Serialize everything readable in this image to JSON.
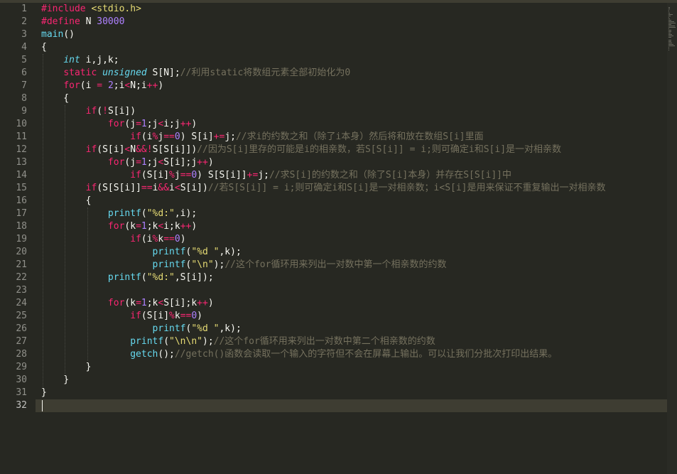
{
  "colors": {
    "background": "#272822",
    "foreground": "#f8f8f2",
    "keyword": "#f92672",
    "type": "#66d9ef",
    "function": "#66d9ef",
    "string": "#e6db74",
    "number": "#ae81ff",
    "comment": "#75715e",
    "line_number": "#90908a"
  },
  "editor": {
    "active_line": 32,
    "lines": [
      {
        "n": "1",
        "tokens": [
          [
            "pp",
            "#include "
          ],
          [
            "st",
            "<stdio.h>"
          ]
        ]
      },
      {
        "n": "2",
        "tokens": [
          [
            "pp",
            "#define "
          ],
          [
            "pl",
            "N "
          ],
          [
            "nu",
            "30000"
          ]
        ]
      },
      {
        "n": "3",
        "tokens": [
          [
            "fn",
            "main"
          ],
          [
            "pl",
            "()"
          ]
        ]
      },
      {
        "n": "4",
        "tokens": [
          [
            "pl",
            "{"
          ]
        ]
      },
      {
        "n": "5",
        "tokens": [
          [
            "pl",
            "    "
          ],
          [
            "ty",
            "int"
          ],
          [
            "pl",
            " i,j,k;"
          ]
        ]
      },
      {
        "n": "6",
        "tokens": [
          [
            "pl",
            "    "
          ],
          [
            "pp",
            "static "
          ],
          [
            "ty",
            "unsigned"
          ],
          [
            "pl",
            " S[N];"
          ],
          [
            "cm",
            "//利用static将数组元素全部初始化为0"
          ]
        ]
      },
      {
        "n": "7",
        "tokens": [
          [
            "pl",
            "    "
          ],
          [
            "pp",
            "for"
          ],
          [
            "pl",
            "(i "
          ],
          [
            "pp",
            "="
          ],
          [
            "pl",
            " "
          ],
          [
            "nu",
            "2"
          ],
          [
            "pl",
            ";i"
          ],
          [
            "pp",
            "<"
          ],
          [
            "pl",
            "N;i"
          ],
          [
            "pp",
            "++"
          ],
          [
            "pl",
            ")"
          ]
        ]
      },
      {
        "n": "8",
        "tokens": [
          [
            "pl",
            "    {"
          ]
        ]
      },
      {
        "n": "9",
        "tokens": [
          [
            "pl",
            "        "
          ],
          [
            "pp",
            "if"
          ],
          [
            "pl",
            "("
          ],
          [
            "pp",
            "!"
          ],
          [
            "pl",
            "S[i])"
          ]
        ]
      },
      {
        "n": "10",
        "tokens": [
          [
            "pl",
            "            "
          ],
          [
            "pp",
            "for"
          ],
          [
            "pl",
            "(j"
          ],
          [
            "pp",
            "="
          ],
          [
            "nu",
            "1"
          ],
          [
            "pl",
            ";j"
          ],
          [
            "pp",
            "<"
          ],
          [
            "pl",
            "i;j"
          ],
          [
            "pp",
            "++"
          ],
          [
            "pl",
            ")"
          ]
        ]
      },
      {
        "n": "11",
        "tokens": [
          [
            "pl",
            "                "
          ],
          [
            "pp",
            "if"
          ],
          [
            "pl",
            "(i"
          ],
          [
            "pp",
            "%"
          ],
          [
            "pl",
            "j"
          ],
          [
            "pp",
            "=="
          ],
          [
            "nu",
            "0"
          ],
          [
            "pl",
            ") S[i]"
          ],
          [
            "pp",
            "+="
          ],
          [
            "pl",
            "j;"
          ],
          [
            "cm",
            "//求i的约数之和（除了i本身）然后将和放在数组S[i]里面"
          ]
        ]
      },
      {
        "n": "12",
        "tokens": [
          [
            "pl",
            "        "
          ],
          [
            "pp",
            "if"
          ],
          [
            "pl",
            "(S[i]"
          ],
          [
            "pp",
            "<"
          ],
          [
            "pl",
            "N"
          ],
          [
            "pp",
            "&&!"
          ],
          [
            "pl",
            "S[S[i]])"
          ],
          [
            "cm",
            "//因为S[i]里存的可能是i的相亲数，若S[S[i]] = i;则可确定i和S[i]是一对相亲数"
          ]
        ]
      },
      {
        "n": "13",
        "tokens": [
          [
            "pl",
            "            "
          ],
          [
            "pp",
            "for"
          ],
          [
            "pl",
            "(j"
          ],
          [
            "pp",
            "="
          ],
          [
            "nu",
            "1"
          ],
          [
            "pl",
            ";j"
          ],
          [
            "pp",
            "<"
          ],
          [
            "pl",
            "S[i];j"
          ],
          [
            "pp",
            "++"
          ],
          [
            "pl",
            ")"
          ]
        ]
      },
      {
        "n": "14",
        "tokens": [
          [
            "pl",
            "                "
          ],
          [
            "pp",
            "if"
          ],
          [
            "pl",
            "(S[i]"
          ],
          [
            "pp",
            "%"
          ],
          [
            "pl",
            "j"
          ],
          [
            "pp",
            "=="
          ],
          [
            "nu",
            "0"
          ],
          [
            "pl",
            ") S[S[i]]"
          ],
          [
            "pp",
            "+="
          ],
          [
            "pl",
            "j;"
          ],
          [
            "cm",
            "//求S[i]的约数之和（除了S[i]本身）并存在S[S[i]]中"
          ]
        ]
      },
      {
        "n": "15",
        "tokens": [
          [
            "pl",
            "        "
          ],
          [
            "pp",
            "if"
          ],
          [
            "pl",
            "(S[S[i]]"
          ],
          [
            "pp",
            "=="
          ],
          [
            "pl",
            "i"
          ],
          [
            "pp",
            "&&"
          ],
          [
            "pl",
            "i"
          ],
          [
            "pp",
            "<"
          ],
          [
            "pl",
            "S[i])"
          ],
          [
            "cm",
            "//若S[S[i]] = i;则可确定i和S[i]是一对相亲数；i<S[i]是用来保证不重复输出一对相亲数"
          ]
        ]
      },
      {
        "n": "16",
        "tokens": [
          [
            "pl",
            "        {"
          ]
        ]
      },
      {
        "n": "17",
        "tokens": [
          [
            "pl",
            "            "
          ],
          [
            "fn",
            "printf"
          ],
          [
            "pl",
            "("
          ],
          [
            "st",
            "\"%d:\""
          ],
          [
            "pl",
            ",i);"
          ]
        ]
      },
      {
        "n": "18",
        "tokens": [
          [
            "pl",
            "            "
          ],
          [
            "pp",
            "for"
          ],
          [
            "pl",
            "(k"
          ],
          [
            "pp",
            "="
          ],
          [
            "nu",
            "1"
          ],
          [
            "pl",
            ";k"
          ],
          [
            "pp",
            "<"
          ],
          [
            "pl",
            "i;k"
          ],
          [
            "pp",
            "++"
          ],
          [
            "pl",
            ")"
          ]
        ]
      },
      {
        "n": "19",
        "tokens": [
          [
            "pl",
            "                "
          ],
          [
            "pp",
            "if"
          ],
          [
            "pl",
            "(i"
          ],
          [
            "pp",
            "%"
          ],
          [
            "pl",
            "k"
          ],
          [
            "pp",
            "=="
          ],
          [
            "nu",
            "0"
          ],
          [
            "pl",
            ")"
          ]
        ]
      },
      {
        "n": "20",
        "tokens": [
          [
            "pl",
            "                    "
          ],
          [
            "fn",
            "printf"
          ],
          [
            "pl",
            "("
          ],
          [
            "st",
            "\"%d \""
          ],
          [
            "pl",
            ",k);"
          ]
        ]
      },
      {
        "n": "21",
        "tokens": [
          [
            "pl",
            "                    "
          ],
          [
            "fn",
            "printf"
          ],
          [
            "pl",
            "("
          ],
          [
            "st",
            "\"\\n\""
          ],
          [
            "pl",
            ");"
          ],
          [
            "cm",
            "//这个for循环用来列出一对数中第一个相亲数的约数"
          ]
        ]
      },
      {
        "n": "22",
        "tokens": [
          [
            "pl",
            "            "
          ],
          [
            "fn",
            "printf"
          ],
          [
            "pl",
            "("
          ],
          [
            "st",
            "\"%d:\""
          ],
          [
            "pl",
            ",S[i]);"
          ]
        ]
      },
      {
        "n": "23",
        "tokens": []
      },
      {
        "n": "24",
        "tokens": [
          [
            "pl",
            "            "
          ],
          [
            "pp",
            "for"
          ],
          [
            "pl",
            "(k"
          ],
          [
            "pp",
            "="
          ],
          [
            "nu",
            "1"
          ],
          [
            "pl",
            ";k"
          ],
          [
            "pp",
            "<"
          ],
          [
            "pl",
            "S[i];k"
          ],
          [
            "pp",
            "++"
          ],
          [
            "pl",
            ")"
          ]
        ]
      },
      {
        "n": "25",
        "tokens": [
          [
            "pl",
            "                "
          ],
          [
            "pp",
            "if"
          ],
          [
            "pl",
            "(S[i]"
          ],
          [
            "pp",
            "%"
          ],
          [
            "pl",
            "k"
          ],
          [
            "pp",
            "=="
          ],
          [
            "nu",
            "0"
          ],
          [
            "pl",
            ")"
          ]
        ]
      },
      {
        "n": "26",
        "tokens": [
          [
            "pl",
            "                    "
          ],
          [
            "fn",
            "printf"
          ],
          [
            "pl",
            "("
          ],
          [
            "st",
            "\"%d \""
          ],
          [
            "pl",
            ",k);"
          ]
        ]
      },
      {
        "n": "27",
        "tokens": [
          [
            "pl",
            "                "
          ],
          [
            "fn",
            "printf"
          ],
          [
            "pl",
            "("
          ],
          [
            "st",
            "\"\\n\\n\""
          ],
          [
            "pl",
            ");"
          ],
          [
            "cm",
            "//这个for循环用来列出一对数中第二个相亲数的约数"
          ]
        ]
      },
      {
        "n": "28",
        "tokens": [
          [
            "pl",
            "                "
          ],
          [
            "fn",
            "getch"
          ],
          [
            "pl",
            "();"
          ],
          [
            "cm",
            "//getch()函数会读取一个输入的字符但不会在屏幕上输出。可以让我们分批次打印出结果。"
          ]
        ]
      },
      {
        "n": "29",
        "tokens": [
          [
            "pl",
            "        }"
          ]
        ]
      },
      {
        "n": "30",
        "tokens": [
          [
            "pl",
            "    }"
          ]
        ]
      },
      {
        "n": "31",
        "tokens": [
          [
            "pl",
            "}"
          ]
        ]
      },
      {
        "n": "32",
        "tokens": []
      }
    ]
  }
}
